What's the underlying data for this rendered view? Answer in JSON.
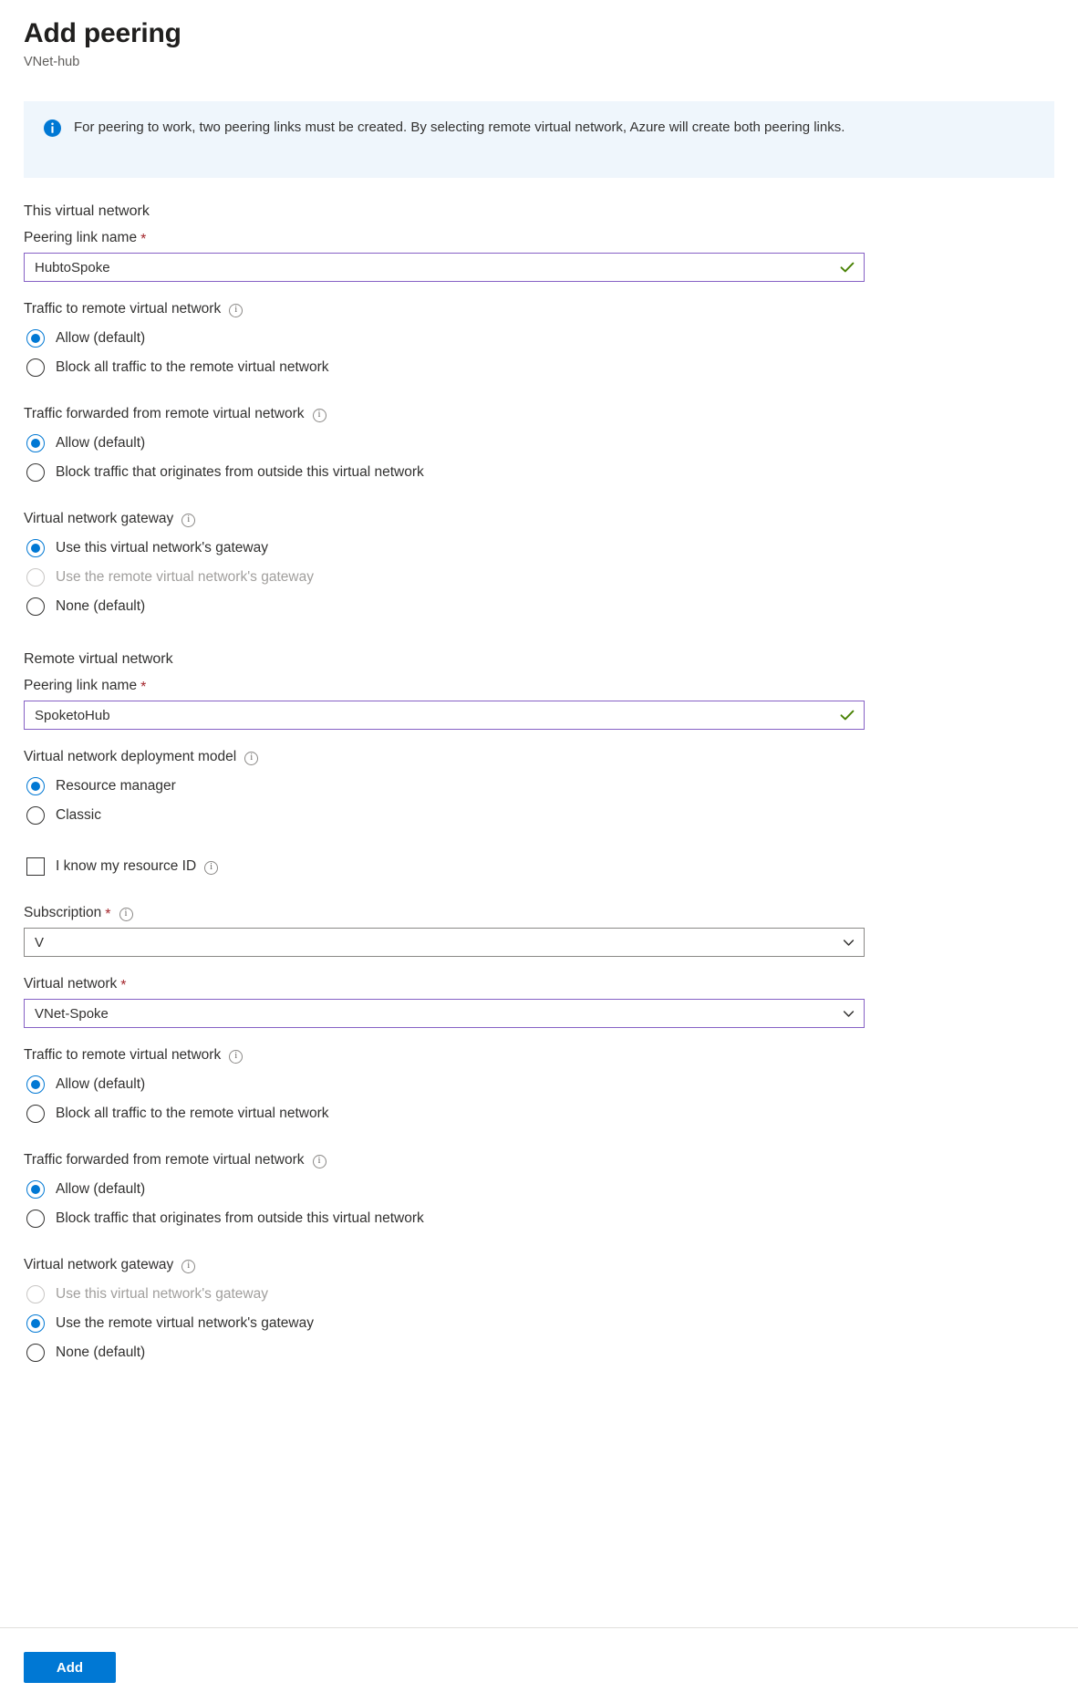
{
  "header": {
    "title": "Add peering",
    "subtitle": "VNet-hub"
  },
  "banner": {
    "icon": "info-circle-icon",
    "text": "For peering to work, two peering links must be created. By selecting remote virtual network, Azure will create both peering links."
  },
  "local_section": {
    "title": "This virtual network",
    "peering_link_name": {
      "label": "Peering link name",
      "required_mark": "*",
      "value": "HubtoSpoke",
      "placeholder": "",
      "valid_icon": "green-check-icon"
    },
    "traffic_to_remote": {
      "label": "Traffic to remote virtual network",
      "info_icon": "info-icon",
      "options": [
        {
          "label": "Allow (default)",
          "checked": true,
          "disabled": false
        },
        {
          "label": "Block all traffic to the remote virtual network",
          "checked": false,
          "disabled": false
        }
      ]
    },
    "traffic_forwarded": {
      "label": "Traffic forwarded from remote virtual network",
      "info_icon": "info-icon",
      "options": [
        {
          "label": "Allow (default)",
          "checked": true,
          "disabled": false
        },
        {
          "label": "Block traffic that originates from outside this virtual network",
          "checked": false,
          "disabled": false
        }
      ]
    },
    "gateway": {
      "label": "Virtual network gateway",
      "info_icon": "info-icon",
      "options": [
        {
          "label": "Use this virtual network's gateway",
          "checked": true,
          "disabled": false
        },
        {
          "label": "Use the remote virtual network's gateway",
          "checked": false,
          "disabled": true
        },
        {
          "label": "None (default)",
          "checked": false,
          "disabled": false
        }
      ]
    }
  },
  "remote_section": {
    "title": "Remote virtual network",
    "peering_link_name": {
      "label": "Peering link name",
      "required_mark": "*",
      "value": "SpoketoHub",
      "placeholder": "",
      "valid_icon": "green-check-icon"
    },
    "deployment_model": {
      "label": "Virtual network deployment model",
      "info_icon": "info-icon",
      "options": [
        {
          "label": "Resource manager",
          "checked": true,
          "disabled": false
        },
        {
          "label": "Classic",
          "checked": false,
          "disabled": false
        }
      ]
    },
    "resource_id_checkbox": {
      "label": "I know my resource ID",
      "info_icon": "info-icon",
      "checked": false
    },
    "subscription": {
      "label": "Subscription",
      "required_mark": "*",
      "info_icon": "info-icon",
      "value": "V",
      "chevron_icon": "chevron-down-icon"
    },
    "virtual_network": {
      "label": "Virtual network",
      "required_mark": "*",
      "value": "VNet-Spoke",
      "chevron_icon": "chevron-down-icon"
    },
    "traffic_to_remote": {
      "label": "Traffic to remote virtual network",
      "info_icon": "info-icon",
      "options": [
        {
          "label": "Allow (default)",
          "checked": true,
          "disabled": false
        },
        {
          "label": "Block all traffic to the remote virtual network",
          "checked": false,
          "disabled": false
        }
      ]
    },
    "traffic_forwarded": {
      "label": "Traffic forwarded from remote virtual network",
      "info_icon": "info-icon",
      "options": [
        {
          "label": "Allow (default)",
          "checked": true,
          "disabled": false
        },
        {
          "label": "Block traffic that originates from outside this virtual network",
          "checked": false,
          "disabled": false
        }
      ]
    },
    "gateway": {
      "label": "Virtual network gateway",
      "info_icon": "info-icon",
      "options": [
        {
          "label": "Use this virtual network's gateway",
          "checked": false,
          "disabled": true
        },
        {
          "label": "Use the remote virtual network's gateway",
          "checked": true,
          "disabled": false
        },
        {
          "label": "None (default)",
          "checked": false,
          "disabled": false
        }
      ]
    }
  },
  "footer": {
    "add_label": "Add"
  },
  "colors": {
    "accent": "#0078d4",
    "valid_border": "#8661c5",
    "required": "#a4262c",
    "banner_bg": "#eff6fc",
    "success": "#498205"
  }
}
